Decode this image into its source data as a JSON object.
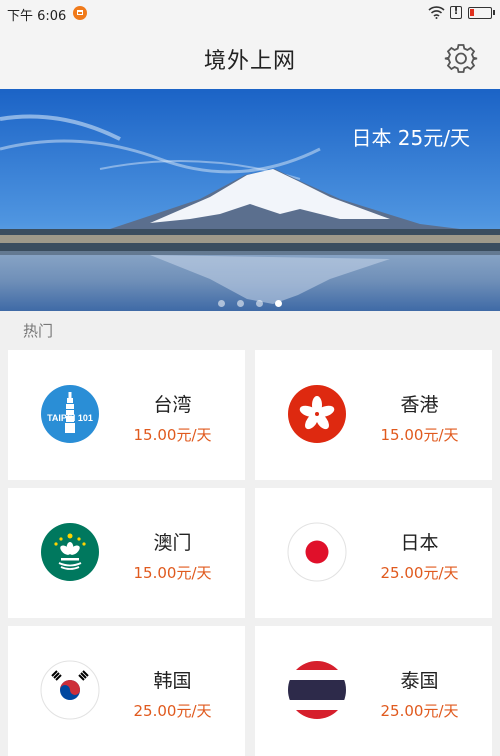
{
  "status_bar": {
    "time": "下午 6:06",
    "alert_symbol": "!"
  },
  "header": {
    "title": "境外上网"
  },
  "banner": {
    "price_text": "日本 25元/天",
    "dots": 4,
    "active_dot": 4
  },
  "section": {
    "label": "热门"
  },
  "destinations": [
    {
      "name": "台湾",
      "price": "15.00元/天",
      "logo_text": "TAIPEI 101"
    },
    {
      "name": "香港",
      "price": "15.00元/天"
    },
    {
      "name": "澳门",
      "price": "15.00元/天"
    },
    {
      "name": "日本",
      "price": "25.00元/天"
    },
    {
      "name": "韩国",
      "price": "25.00元/天"
    },
    {
      "name": "泰国",
      "price": "25.00元/天"
    }
  ],
  "colors": {
    "price": "#e05a1e",
    "background": "#f0f0f0",
    "card": "#ffffff"
  }
}
